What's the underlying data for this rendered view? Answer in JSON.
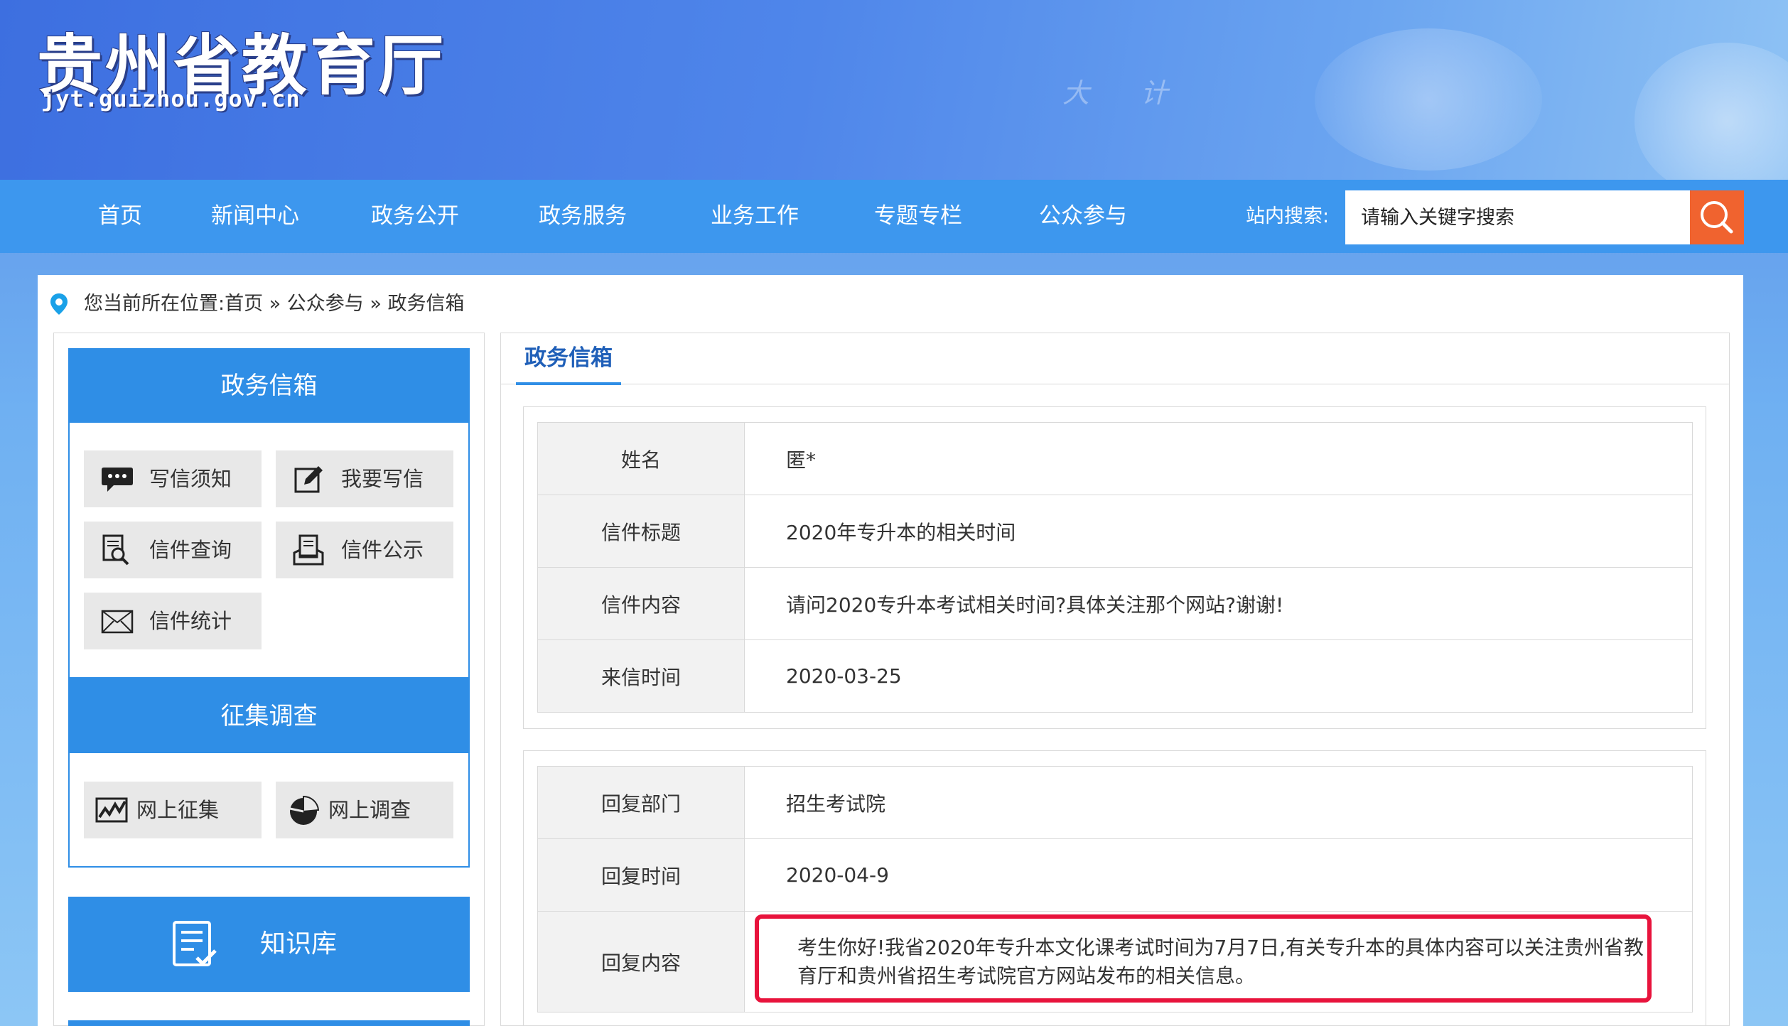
{
  "header": {
    "logo_text": "贵州省教育厅",
    "logo_domain": "jyt.guizhou.gov.cn",
    "deco_text": "大 计"
  },
  "nav": {
    "items": [
      "首页",
      "新闻中心",
      "政务公开",
      "政务服务",
      "业务工作",
      "专题专栏",
      "公众参与"
    ],
    "search_label": "站内搜索:",
    "search_placeholder": "请输入关键字搜索",
    "search_icon": "search-icon"
  },
  "breadcrumb": {
    "text": "您当前所在位置:首页 » 公众参与 » 政务信箱",
    "icon": "location-pin-icon"
  },
  "sidebar": {
    "mailbox": {
      "title": "政务信箱",
      "items": [
        {
          "label": "写信须知",
          "icon": "speech-bubble-icon"
        },
        {
          "label": "我要写信",
          "icon": "edit-icon"
        },
        {
          "label": "信件查询",
          "icon": "magnifier-doc-icon"
        },
        {
          "label": "信件公示",
          "icon": "document-stack-icon"
        },
        {
          "label": "信件统计",
          "icon": "envelope-icon"
        }
      ]
    },
    "survey": {
      "title": "征集调查",
      "items": [
        {
          "label": "网上征集",
          "icon": "line-chart-icon"
        },
        {
          "label": "网上调查",
          "icon": "pie-chart-icon"
        }
      ]
    },
    "knowledge": {
      "label": "知识库",
      "icon": "checklist-icon"
    }
  },
  "content": {
    "tab_title": "政务信箱",
    "letter": [
      {
        "key": "姓名",
        "value": "匿*"
      },
      {
        "key": "信件标题",
        "value": "2020年专升本的相关时间"
      },
      {
        "key": "信件内容",
        "value": "请问2020专升本考试相关时间?具体关注那个网站?谢谢!"
      },
      {
        "key": "来信时间",
        "value": "2020-03-25"
      }
    ],
    "reply": [
      {
        "key": "回复部门",
        "value": "招生考试院"
      },
      {
        "key": "回复时间",
        "value": "2020-04-9"
      },
      {
        "key": "回复内容",
        "value": "考生你好!我省2020年专升本文化课考试时间为7月7日,有关专升本的具体内容可以关注贵州省教育厅和贵州省招生考试院官方网站发布的相关信息。"
      }
    ]
  },
  "colors": {
    "nav": "#3d97ee",
    "panel_blue": "#2f8ee6",
    "search_button": "#f0632f",
    "highlight": "#e8133c"
  }
}
